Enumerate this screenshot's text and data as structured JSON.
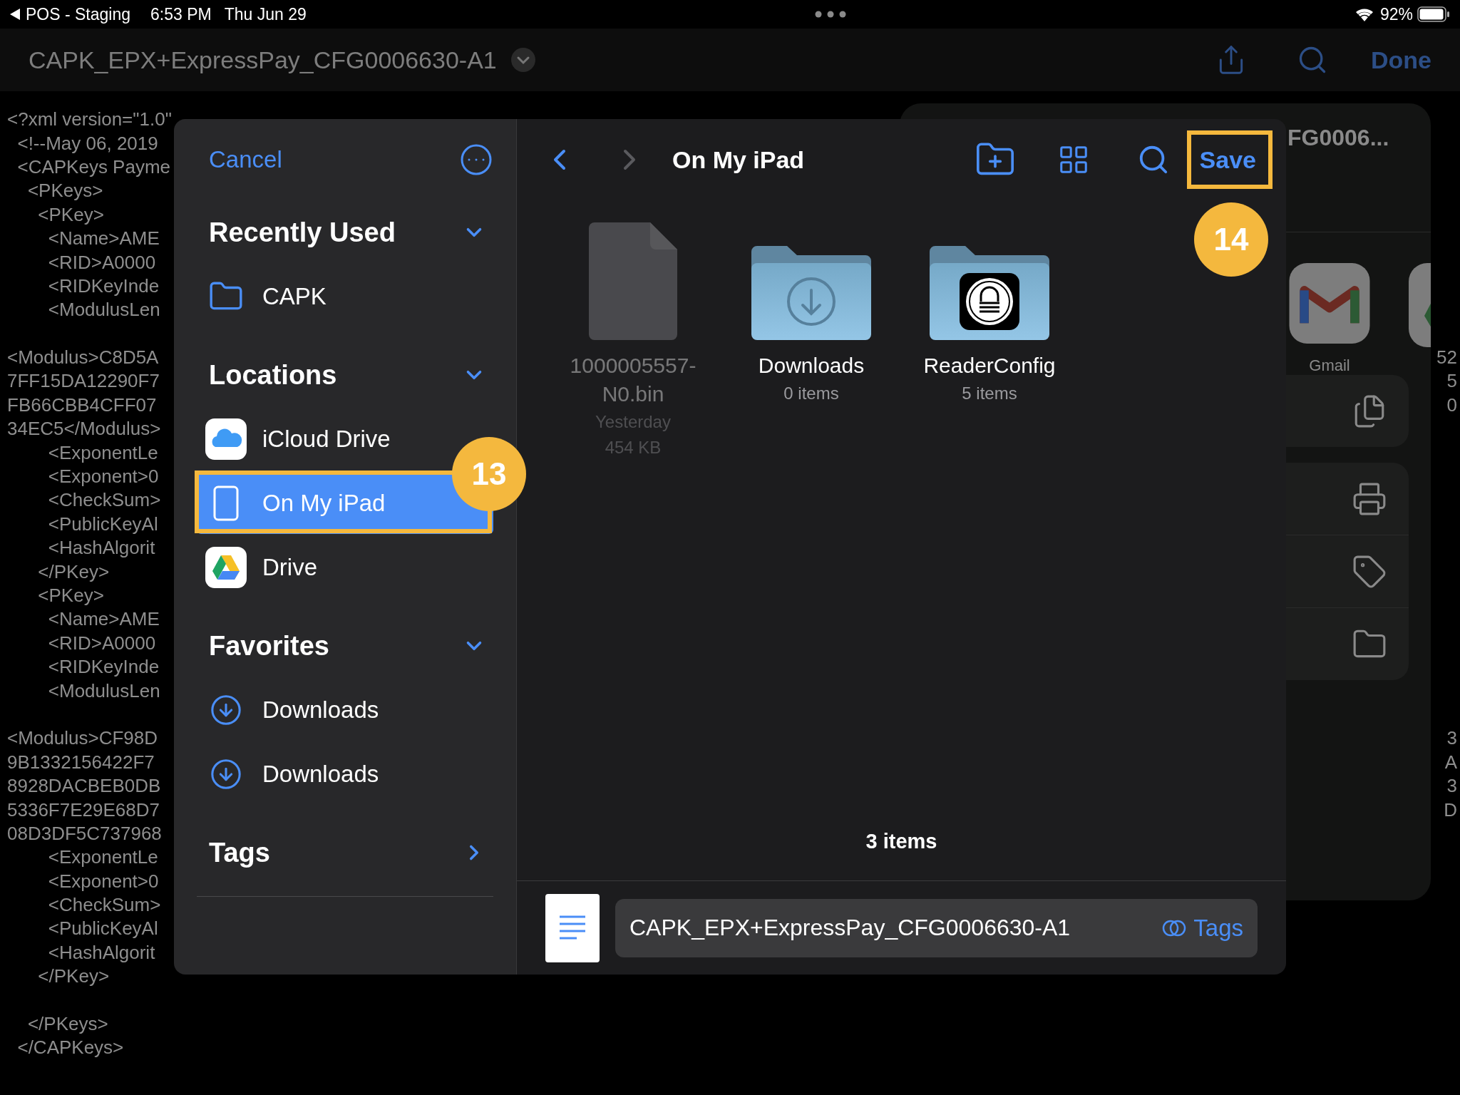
{
  "status_bar": {
    "back_app": "POS - Staging",
    "time": "6:53 PM",
    "date": "Thu Jun 29",
    "battery": "92%"
  },
  "nav_bar": {
    "title": "CAPK_EPX+ExpressPay_CFG0006630-A1",
    "done": "Done"
  },
  "document": {
    "lines": [
      {
        "kind": "line",
        "text": "<?xml version=\"1.0\""
      },
      {
        "kind": "line",
        "text": "  <!--May 06, 2019"
      },
      {
        "kind": "line",
        "text": "  <CAPKeys Payme"
      },
      {
        "kind": "line",
        "text": "    <PKeys>"
      },
      {
        "kind": "line",
        "text": "      <PKey>"
      },
      {
        "kind": "line",
        "text": "        <Name>AME"
      },
      {
        "kind": "line",
        "text": "        <RID>A0000"
      },
      {
        "kind": "line",
        "text": "        <RIDKeyInde"
      },
      {
        "kind": "line",
        "text": "        <ModulusLen"
      },
      {
        "kind": "gap"
      },
      {
        "kind": "line",
        "text": "<Modulus>C8D5A",
        "tail": "52"
      },
      {
        "kind": "line",
        "text": "7FF15DA12290F7",
        "tail": "5"
      },
      {
        "kind": "line",
        "text": "FB66CBB4CFF07",
        "tail": "0"
      },
      {
        "kind": "line",
        "text": "34EC5</Modulus>"
      },
      {
        "kind": "line",
        "text": "        <ExponentLe"
      },
      {
        "kind": "line",
        "text": "        <Exponent>0"
      },
      {
        "kind": "line",
        "text": "        <CheckSum>"
      },
      {
        "kind": "line",
        "text": "        <PublicKeyAl"
      },
      {
        "kind": "line",
        "text": "        <HashAlgorit"
      },
      {
        "kind": "line",
        "text": "      </PKey>"
      },
      {
        "kind": "line",
        "text": "      <PKey>"
      },
      {
        "kind": "line",
        "text": "        <Name>AME"
      },
      {
        "kind": "line",
        "text": "        <RID>A0000"
      },
      {
        "kind": "line",
        "text": "        <RIDKeyInde"
      },
      {
        "kind": "line",
        "text": "        <ModulusLen"
      },
      {
        "kind": "gap"
      },
      {
        "kind": "line",
        "text": "<Modulus>CF98D",
        "tail": "3"
      },
      {
        "kind": "line",
        "text": "9B1332156422F7",
        "tail": "A"
      },
      {
        "kind": "line",
        "text": "8928DACBEB0DB",
        "tail": "3"
      },
      {
        "kind": "line",
        "text": "5336F7E29E68D7",
        "tail": "D"
      },
      {
        "kind": "line",
        "text": "08D3DF5C737968"
      },
      {
        "kind": "line",
        "text": "        <ExponentLe"
      },
      {
        "kind": "line",
        "text": "        <Exponent>0"
      },
      {
        "kind": "line",
        "text": "        <CheckSum>"
      },
      {
        "kind": "line",
        "text": "        <PublicKeyAl"
      },
      {
        "kind": "line",
        "text": "        <HashAlgorit"
      },
      {
        "kind": "line",
        "text": "      </PKey>"
      },
      {
        "kind": "gap"
      },
      {
        "kind": "line",
        "text": "    </PKeys>"
      },
      {
        "kind": "line",
        "text": "  </CAPKeys>"
      }
    ]
  },
  "share_sheet": {
    "title": "FG0006...",
    "apps": [
      {
        "kind": "gmail",
        "label": "Gmail"
      },
      {
        "kind": "drive"
      }
    ]
  },
  "dialog": {
    "cancel": "Cancel",
    "sidebar": [
      {
        "title": "Recently Used",
        "expanded": true,
        "items": [
          {
            "kind": "folder",
            "label": "CAPK",
            "selected": false
          }
        ]
      },
      {
        "title": "Locations",
        "expanded": true,
        "items": [
          {
            "kind": "icloud",
            "label": "iCloud Drive",
            "selected": false
          },
          {
            "kind": "ipad",
            "label": "On My iPad",
            "selected": true
          },
          {
            "kind": "drive",
            "label": "Drive",
            "selected": false
          }
        ]
      },
      {
        "title": "Favorites",
        "expanded": true,
        "items": [
          {
            "kind": "download",
            "label": "Downloads",
            "selected": false
          },
          {
            "kind": "download",
            "label": "Downloads",
            "selected": false
          }
        ]
      },
      {
        "title": "Tags",
        "expanded": false
      }
    ],
    "location_title": "On My iPad",
    "save": "Save",
    "files": [
      {
        "kind": "document",
        "name": "1000005557-N0.bin",
        "date": "Yesterday",
        "size": "454 KB",
        "disabled": true
      },
      {
        "kind": "downloads_folder",
        "name": "Downloads",
        "count": "0 items",
        "disabled": false
      },
      {
        "kind": "app_folder",
        "name": "ReaderConfig",
        "count": "5 items",
        "disabled": false
      }
    ],
    "item_count": "3 items",
    "filename": "CAPK_EPX+ExpressPay_CFG0006630-A1",
    "tags": "Tags"
  },
  "annotations": [
    {
      "label": "13"
    },
    {
      "label": "14"
    }
  ]
}
